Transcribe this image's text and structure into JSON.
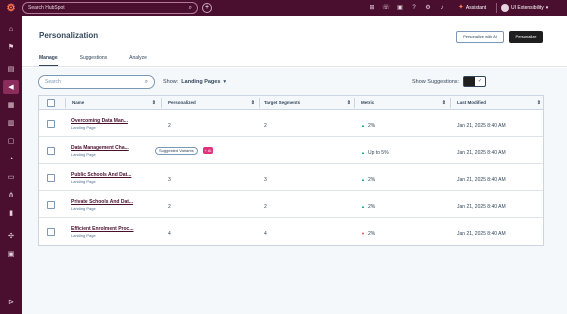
{
  "topnav": {
    "search_placeholder": "Search HubSpot",
    "assistant_label": "Assistant",
    "account_name": "UI Extensibility",
    "icons": [
      "grid-icon",
      "phone-icon",
      "store-icon",
      "help-icon",
      "gear-icon",
      "bell-icon"
    ]
  },
  "sidebar": {
    "items": [
      "home-icon",
      "bookmark-icon",
      "reports-icon",
      "marketing-icon",
      "content-icon",
      "commerce-icon",
      "documents-icon",
      "service-icon",
      "data-icon",
      "automation-icon",
      "analytics-icon",
      "integrations-icon",
      "apps-icon"
    ],
    "active_index": 3
  },
  "header": {
    "title": "Personalization",
    "personalize_ai_label": "Personalize with AI",
    "personalize_label": "Personalize",
    "tabs": [
      "Manage",
      "Suggestions",
      "Analyze"
    ],
    "active_tab": "Manage"
  },
  "filters": {
    "search_placeholder": "Search",
    "show_label": "Show:",
    "show_value": "Landing Pages",
    "suggestions_label": "Show Suggestions:"
  },
  "table": {
    "columns": [
      "Name",
      "Personalized",
      "Target Segments",
      "Metric",
      "Last Modified"
    ],
    "rows": [
      {
        "name": "Overcoming Data Man...",
        "type": "Landing Page",
        "personalized": "2",
        "segments": "2",
        "metric": "2%",
        "trend": "up",
        "modified": "Jan 21, 2025 8:40 AM"
      },
      {
        "name": "Data Management Cha...",
        "type": "Landing Page",
        "personalized": "Suggested Variants",
        "badge": "+ AI",
        "segments": "",
        "metric": "Up to 5%",
        "trend": "up",
        "modified": "Jan 21, 2025 8:40 AM"
      },
      {
        "name": "Public Schools And Dat...",
        "type": "Landing Page",
        "personalized": "3",
        "segments": "3",
        "metric": "2%",
        "trend": "up",
        "modified": "Jan 21, 2025 8:40 AM"
      },
      {
        "name": "Private Schools And Dat...",
        "type": "Landing Page",
        "personalized": "2",
        "segments": "2",
        "metric": "2%",
        "trend": "up",
        "modified": "Jan 21, 2025 8:40 AM"
      },
      {
        "name": "Efficient Enrolment Proc...",
        "type": "Landing Page",
        "personalized": "4",
        "segments": "4",
        "metric": "2%",
        "trend": "down",
        "modified": "Jan 21, 2025 8:40 AM"
      }
    ]
  },
  "colors": {
    "nav_bg": "#4a0f2e",
    "active_nav": "#8a2c5c",
    "link": "#4a0f2e",
    "up": "#00a38d",
    "down": "#d9383f",
    "ai_badge": "#e0317a"
  }
}
